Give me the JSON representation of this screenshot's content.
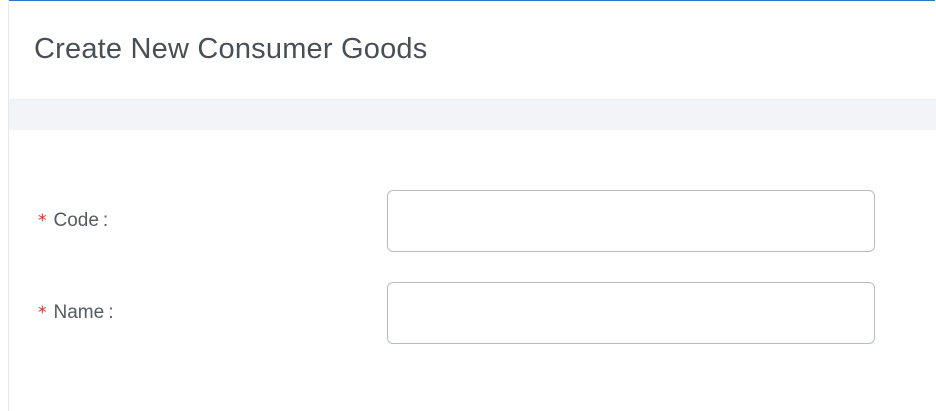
{
  "dialog": {
    "title": "Create New Consumer Goods"
  },
  "form": {
    "fields": [
      {
        "required_mark": "*",
        "label": "Code",
        "colon": ":",
        "value": "",
        "placeholder": ""
      },
      {
        "required_mark": "*",
        "label": "Name",
        "colon": ":",
        "value": "",
        "placeholder": ""
      }
    ]
  },
  "colors": {
    "frame_border": "#2b78c5",
    "required": "#e2231a",
    "header_band": "#f2f4f7",
    "input_border": "#b8bcc2",
    "title_text": "#4a4f55"
  }
}
